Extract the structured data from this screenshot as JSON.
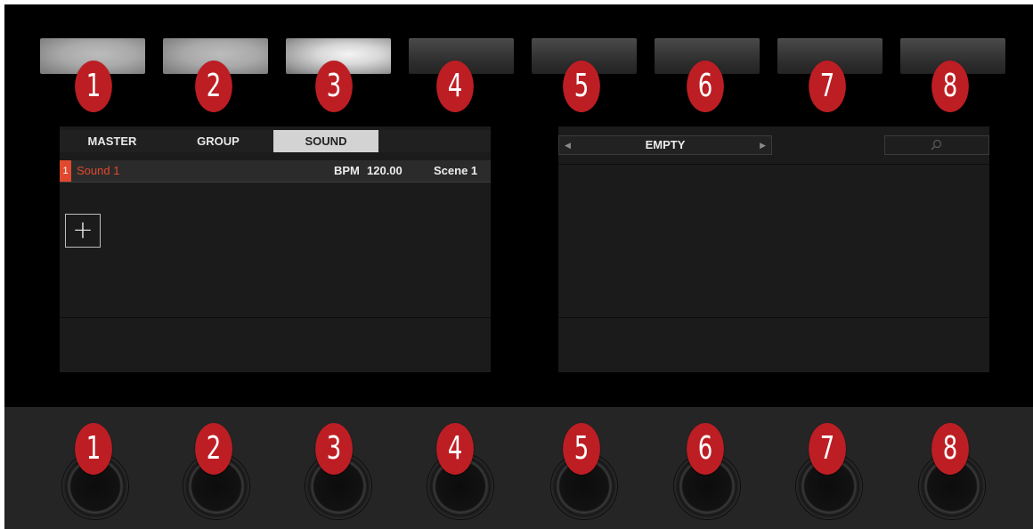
{
  "buttons": [
    "1",
    "2",
    "3",
    "4",
    "5",
    "6",
    "7",
    "8"
  ],
  "knobs": [
    "1",
    "2",
    "3",
    "4",
    "5",
    "6",
    "7",
    "8"
  ],
  "left_display": {
    "tabs": [
      "MASTER",
      "GROUP",
      "SOUND"
    ],
    "active_tab": "SOUND",
    "sound_slot": {
      "number": "1",
      "name": "Sound 1"
    },
    "bpm_label": "BPM",
    "bpm_value": "120.00",
    "scene": "Scene 1",
    "add_symbol": "+"
  },
  "right_display": {
    "nav_label": "EMPTY",
    "nav_prev": "◀",
    "nav_next": "▶"
  },
  "colors": {
    "badge": "#bd1e24",
    "accent": "#e0492d",
    "active_tab": "#d3d3d3"
  }
}
